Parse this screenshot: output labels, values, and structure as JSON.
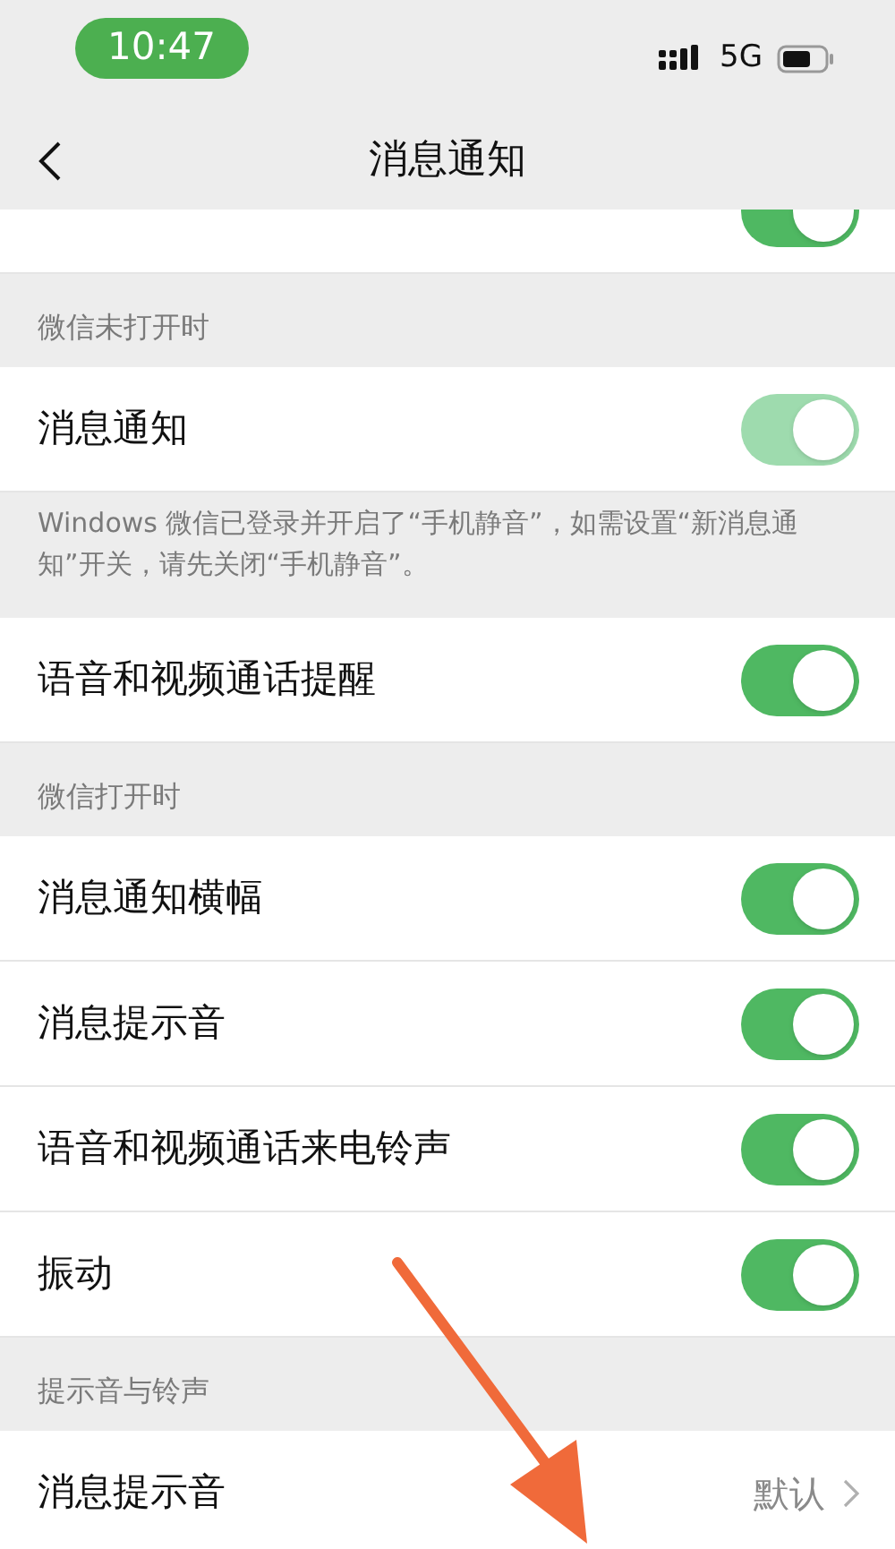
{
  "status_bar": {
    "time": "10:47",
    "network": "5G"
  },
  "nav": {
    "title": "消息通知"
  },
  "items": [
    {
      "kind": "toggle",
      "on": true,
      "disabled": false,
      "partial": true
    },
    {
      "kind": "header",
      "label": "微信未打开时"
    },
    {
      "kind": "toggle",
      "label": "消息通知",
      "on": true,
      "disabled": true
    },
    {
      "kind": "note",
      "label": "Windows 微信已登录并开启了“手机静音”，如需设置“新消息通知”开关，请先关闭“手机静音”。"
    },
    {
      "kind": "toggle",
      "label": "语音和视频通话提醒",
      "on": true,
      "disabled": false
    },
    {
      "kind": "header",
      "label": "微信打开时"
    },
    {
      "kind": "toggle",
      "label": "消息通知横幅",
      "on": true,
      "disabled": false
    },
    {
      "kind": "toggle",
      "label": "消息提示音",
      "on": true,
      "disabled": false
    },
    {
      "kind": "toggle",
      "label": "语音和视频通话来电铃声",
      "on": true,
      "disabled": false
    },
    {
      "kind": "toggle",
      "label": "振动",
      "on": true,
      "disabled": false
    },
    {
      "kind": "header",
      "label": "提示音与铃声"
    },
    {
      "kind": "link",
      "label": "消息提示音",
      "value": "默认"
    }
  ]
}
